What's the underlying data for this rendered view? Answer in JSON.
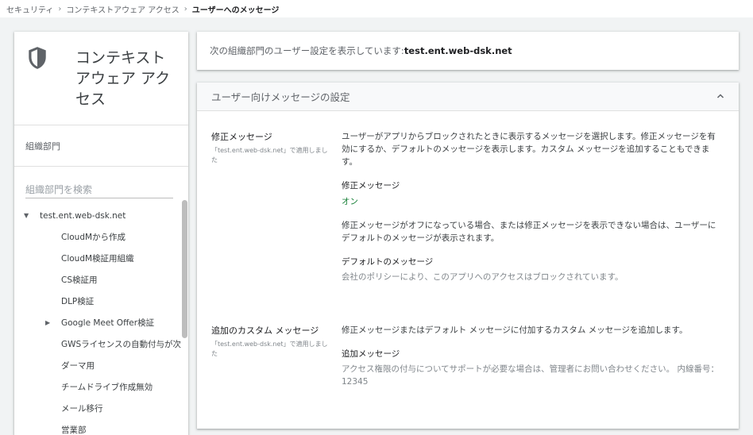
{
  "breadcrumb": {
    "items": [
      "セキュリティ",
      "コンテキストアウェア アクセス"
    ],
    "separator": "›",
    "current": "ユーザーへのメッセージ"
  },
  "sidebar": {
    "app_title": "コンテキスト アウェア アク セス",
    "app_icon": "shield-icon",
    "ou_label": "組織部門",
    "search_placeholder": "組織部門を検索",
    "tree": {
      "root": "test.ent.web-dsk.net",
      "children": [
        "CloudMから作成",
        "CloudM検証用組織",
        "CS検証用",
        "DLP検証",
        "Google Meet Offer検証",
        "GWSライセンスの自動付与が次",
        "ダーマ用",
        "チームドライブ作成無効",
        "メール移行",
        "営業部"
      ]
    }
  },
  "info": {
    "prefix": "次の組織部門のユーザー設定を表示しています: ",
    "domain": "test.ent.web-dsk.net"
  },
  "settings": {
    "title": "ユーザー向けメッセージの設定",
    "remediation": {
      "label": "修正メッセージ",
      "applied": "「test.ent.web-dsk.net」で適用しました",
      "description": "ユーザーがアプリからブロックされたときに表示するメッセージを選択します。修正メッセージを有効にするか、デフォルトのメッセージを表示します。カスタム メッセージを追加することもできます。",
      "sub_title": "修正メッセージ",
      "status": "オン",
      "note": "修正メッセージがオフになっている場合、または修正メッセージを表示できない場合は、ユーザーにデフォルトのメッセージが表示されます。",
      "default_title": "デフォルトのメッセージ",
      "default_text": "会社のポリシーにより、このアプリへのアクセスはブロックされています。"
    },
    "custom": {
      "label": "追加のカスタム メッセージ",
      "applied": "「test.ent.web-dsk.net」で適用しました",
      "description": "修正メッセージまたはデフォルト メッセージに付加するカスタム メッセージを追加します。",
      "sub_title": "追加メッセージ",
      "text": "アクセス権限の付与についてサポートが必要な場合は、管理者にお問い合わせください。 内線番号：12345"
    }
  },
  "colors": {
    "accent_on": "#188038",
    "background": "#f1f3f4"
  }
}
